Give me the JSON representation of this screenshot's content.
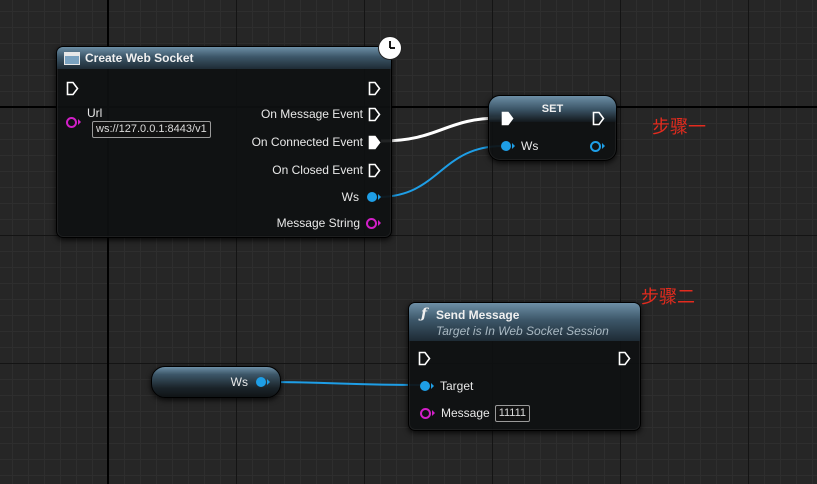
{
  "create_node": {
    "title": "Create Web Socket",
    "url_label": "Url",
    "url_value": "ws://127.0.0.1:8443/v1",
    "outputs": {
      "on_message": "On Message Event",
      "on_connected": "On Connected Event",
      "on_closed": "On Closed Event",
      "ws": "Ws",
      "message_string": "Message String"
    }
  },
  "set_node": {
    "title": "SET",
    "ws_label": "Ws"
  },
  "send_node": {
    "title": "Send Message",
    "subtitle": "Target is In Web Socket Session",
    "target_label": "Target",
    "message_label": "Message",
    "message_value": "11111"
  },
  "ws_var_node": {
    "label": "Ws"
  },
  "annotations": {
    "step1": "步骤一",
    "step2": "步骤二"
  },
  "colors": {
    "exec": "#ffffff",
    "object_pin": "#1e9ee6",
    "string_pin": "#d21fc8",
    "annotation": "#e32b1e",
    "node_header": "#3c5668"
  },
  "icons": {
    "create_node": "function-block-icon",
    "latent": "clock-icon",
    "send_node": "function-f-icon"
  }
}
